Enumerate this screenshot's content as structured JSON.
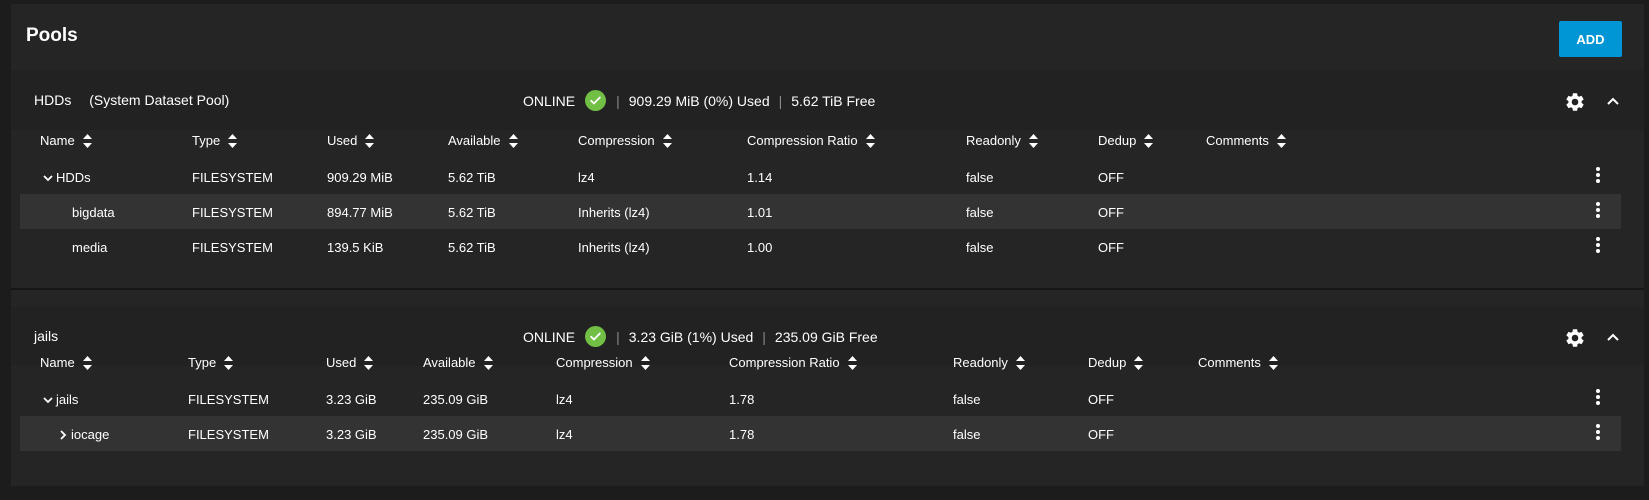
{
  "page": {
    "title": "Pools",
    "add_label": "ADD"
  },
  "colors": {
    "accent": "#0095d5",
    "online": "#71bf44",
    "row_alt": "#333333"
  },
  "icons": {
    "status": "check-circle-icon",
    "settings": "gear-icon",
    "collapse": "chevron-up-icon",
    "sort": "sort-icon",
    "row_menu": "more-vertical-icon"
  },
  "pools": [
    {
      "name": "HDDs",
      "note": "(System Dataset Pool)",
      "status": "ONLINE",
      "used": "909.29 MiB (0%) Used",
      "free": "5.62 TiB Free",
      "columns": [
        "Name",
        "Type",
        "Used",
        "Available",
        "Compression",
        "Compression Ratio",
        "Readonly",
        "Dedup",
        "Comments"
      ],
      "rows": [
        {
          "name": "HDDs",
          "type": "FILESYSTEM",
          "used": "909.29 MiB",
          "available": "5.62 TiB",
          "compression": "lz4",
          "ratio": "1.14",
          "readonly": "false",
          "dedup": "OFF",
          "comments": ""
        },
        {
          "name": "bigdata",
          "type": "FILESYSTEM",
          "used": "894.77 MiB",
          "available": "5.62 TiB",
          "compression": "Inherits (lz4)",
          "ratio": "1.01",
          "readonly": "false",
          "dedup": "OFF",
          "comments": ""
        },
        {
          "name": "media",
          "type": "FILESYSTEM",
          "used": "139.5 KiB",
          "available": "5.62 TiB",
          "compression": "Inherits (lz4)",
          "ratio": "1.00",
          "readonly": "false",
          "dedup": "OFF",
          "comments": ""
        }
      ]
    },
    {
      "name": "jails",
      "note": "",
      "status": "ONLINE",
      "used": "3.23 GiB (1%) Used",
      "free": "235.09 GiB Free",
      "columns": [
        "Name",
        "Type",
        "Used",
        "Available",
        "Compression",
        "Compression Ratio",
        "Readonly",
        "Dedup",
        "Comments"
      ],
      "rows": [
        {
          "name": "jails",
          "type": "FILESYSTEM",
          "used": "3.23 GiB",
          "available": "235.09 GiB",
          "compression": "lz4",
          "ratio": "1.78",
          "readonly": "false",
          "dedup": "OFF",
          "comments": ""
        },
        {
          "name": "iocage",
          "type": "FILESYSTEM",
          "used": "3.23 GiB",
          "available": "235.09 GiB",
          "compression": "lz4",
          "ratio": "1.78",
          "readonly": "false",
          "dedup": "OFF",
          "comments": ""
        }
      ]
    }
  ]
}
